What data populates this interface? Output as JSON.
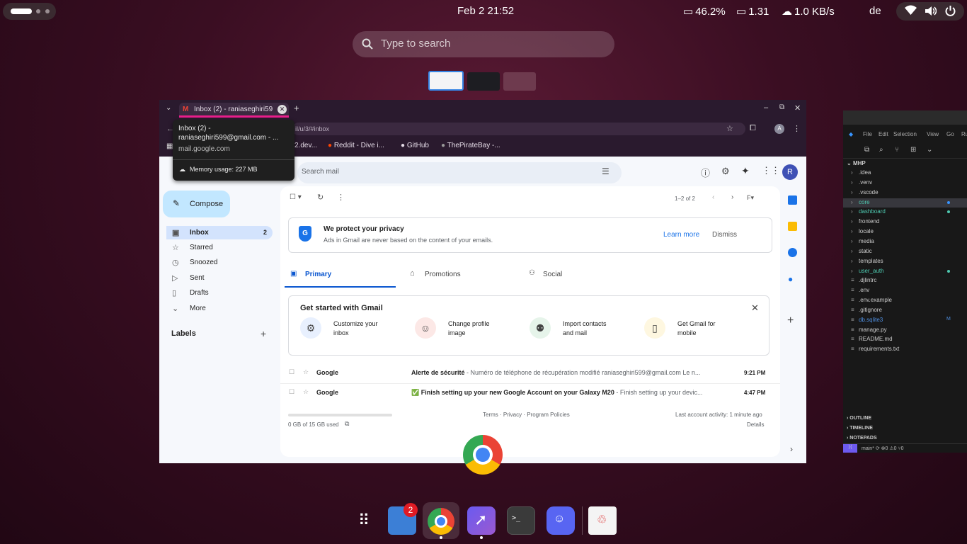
{
  "topbar": {
    "clock": "Feb 2  21:52",
    "battery": "46.2%",
    "load": "1.31",
    "net": "1.0 KB/s",
    "lang": "de"
  },
  "search": {
    "placeholder": "Type to search"
  },
  "chrome": {
    "tab_title": "Inbox (2) - raniaseghiri59",
    "url": "il/u/3/#inbox",
    "bookmarks": [
      "2.dev...",
      "Reddit - Dive i...",
      "GitHub",
      "ThePirateBay -..."
    ],
    "tooltip": {
      "title_line1": "Inbox (2) -",
      "title_line2": "raniaseghiri599@gmail.com - ...",
      "domain": "mail.google.com",
      "memory": "Memory usage: 227 MB"
    },
    "profile_initial": "A"
  },
  "gmail": {
    "search_placeholder": "Search mail",
    "avatar": "R",
    "compose": "Compose",
    "nav": [
      {
        "label": "Inbox",
        "count": "2",
        "icon": "inbox-icon"
      },
      {
        "label": "Starred",
        "count": "",
        "icon": "star-icon"
      },
      {
        "label": "Snoozed",
        "count": "",
        "icon": "clock-icon"
      },
      {
        "label": "Sent",
        "count": "",
        "icon": "send-icon"
      },
      {
        "label": "Drafts",
        "count": "",
        "icon": "draft-icon"
      },
      {
        "label": "More",
        "count": "",
        "icon": "chevron-down-icon"
      }
    ],
    "labels_heading": "Labels",
    "pagination": "1–2 of 2",
    "privacy": {
      "title": "We protect your privacy",
      "body": "Ads in Gmail are never based on the content of your emails.",
      "learn_more": "Learn more",
      "dismiss": "Dismiss"
    },
    "tabs": [
      "Primary",
      "Promotions",
      "Social"
    ],
    "get_started": {
      "title": "Get started with Gmail",
      "items": [
        {
          "l1": "Customize your",
          "l2": "inbox"
        },
        {
          "l1": "Change profile",
          "l2": "image"
        },
        {
          "l1": "Import contacts",
          "l2": "and mail"
        },
        {
          "l1": "Get Gmail for",
          "l2": "mobile"
        }
      ]
    },
    "emails": [
      {
        "sender": "Google",
        "subject": "Alerte de sécurité",
        "snippet": " - Numéro de téléphone de récupération modifié raniaseghiri599@gmail.com Le n...",
        "time": "9:21 PM"
      },
      {
        "sender": "Google",
        "subject": "✅ Finish setting up your new Google Account on your Galaxy M20",
        "snippet": " - Finish setting up your devic...",
        "time": "4:47 PM"
      }
    ],
    "footer": {
      "storage": "0 GB of 15 GB used",
      "links": "Terms · Privacy · Program Policies",
      "activity": "Last account activity: 1 minute ago",
      "details": "Details"
    }
  },
  "vscode": {
    "menu": [
      "File",
      "Edit",
      "Selection",
      "View",
      "Go",
      "Ru"
    ],
    "project": "MHP",
    "files": [
      {
        "name": ".idea",
        "color": "#cccccc",
        "type": "folder"
      },
      {
        "name": ".venv",
        "color": "#cccccc",
        "type": "folder"
      },
      {
        "name": ".vscode",
        "color": "#cccccc",
        "type": "folder"
      },
      {
        "name": "core",
        "color": "#4ec9b0",
        "type": "folder"
      },
      {
        "name": "dashboard",
        "color": "#4ec9b0",
        "type": "folder"
      },
      {
        "name": "frontend",
        "color": "#cccccc",
        "type": "folder"
      },
      {
        "name": "locale",
        "color": "#cccccc",
        "type": "folder"
      },
      {
        "name": "media",
        "color": "#cccccc",
        "type": "folder"
      },
      {
        "name": "static",
        "color": "#cccccc",
        "type": "folder"
      },
      {
        "name": "templates",
        "color": "#cccccc",
        "type": "folder"
      },
      {
        "name": "user_auth",
        "color": "#4ec9b0",
        "type": "folder"
      },
      {
        "name": ".djlintrc",
        "color": "#cccccc",
        "type": "file"
      },
      {
        "name": ".env",
        "color": "#cccccc",
        "type": "file"
      },
      {
        "name": ".env.example",
        "color": "#cccccc",
        "type": "file"
      },
      {
        "name": ".gitignore",
        "color": "#cccccc",
        "type": "file"
      },
      {
        "name": "db.sqlite3",
        "color": "#4f8fe0",
        "type": "file",
        "badge": "M"
      },
      {
        "name": "manage.py",
        "color": "#cccccc",
        "type": "file"
      },
      {
        "name": "README.md",
        "color": "#cccccc",
        "type": "file"
      },
      {
        "name": "requirements.txt",
        "color": "#cccccc",
        "type": "file"
      }
    ],
    "sections": [
      "OUTLINE",
      "TIMELINE",
      "NOTEPADS"
    ],
    "status": "main*  ⟳  ⊗0 ⚠0  ⑂0"
  },
  "dock": {
    "files_badge": "2"
  }
}
